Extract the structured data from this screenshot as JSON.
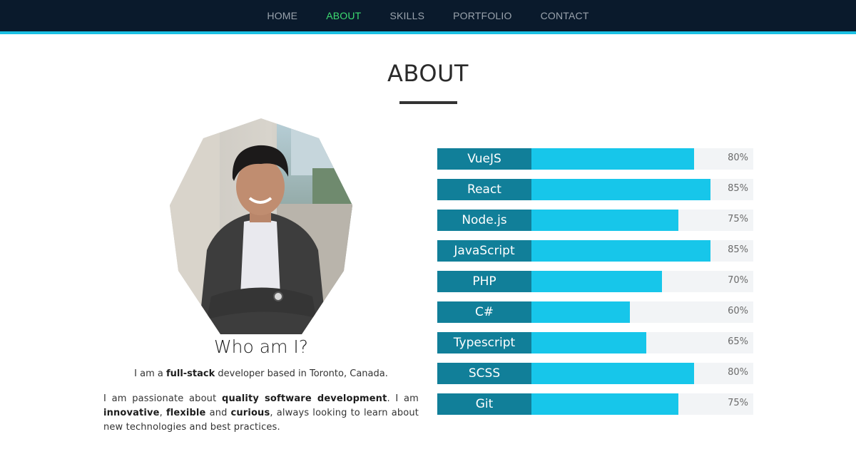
{
  "nav": {
    "items": [
      "HOME",
      "ABOUT",
      "SKILLS",
      "PORTFOLIO",
      "CONTACT"
    ],
    "active_index": 1,
    "active_color": "#3ddc71",
    "bar_color": "#0a1a2c",
    "accent_color": "#1bc0e3"
  },
  "about": {
    "title": "ABOUT",
    "who_title": "Who am I?",
    "intro_1": "I am a ",
    "intro_bold": "full-stack",
    "intro_2": " developer based in Toronto, Canada.",
    "desc_1": "I am passionate about ",
    "desc_b1": "quality software development",
    "desc_2": ". I am ",
    "desc_b2": "innovative",
    "desc_3": ", ",
    "desc_b3": "flexible",
    "desc_4": " and ",
    "desc_b4": "curious",
    "desc_5": ", always looking to learn about new technologies and best practices.",
    "photo_icon": "profile-photo"
  },
  "skills": {
    "label_color": "#117f99",
    "fill_color": "#17c6ea",
    "track_color": "#f2f4f6",
    "items": [
      {
        "name": "VueJS",
        "percent_label": "80%",
        "level": 80
      },
      {
        "name": "React",
        "percent_label": "85%",
        "level": 85
      },
      {
        "name": "Node.js",
        "percent_label": "75%",
        "level": 75
      },
      {
        "name": "JavaScript",
        "percent_label": "85%",
        "level": 85
      },
      {
        "name": "PHP",
        "percent_label": "70%",
        "level": 70
      },
      {
        "name": "C#",
        "percent_label": "60%",
        "level": 60
      },
      {
        "name": "Typescript",
        "percent_label": "65%",
        "level": 65
      },
      {
        "name": "SCSS",
        "percent_label": "80%",
        "level": 80
      },
      {
        "name": "Git",
        "percent_label": "75%",
        "level": 75
      }
    ]
  }
}
